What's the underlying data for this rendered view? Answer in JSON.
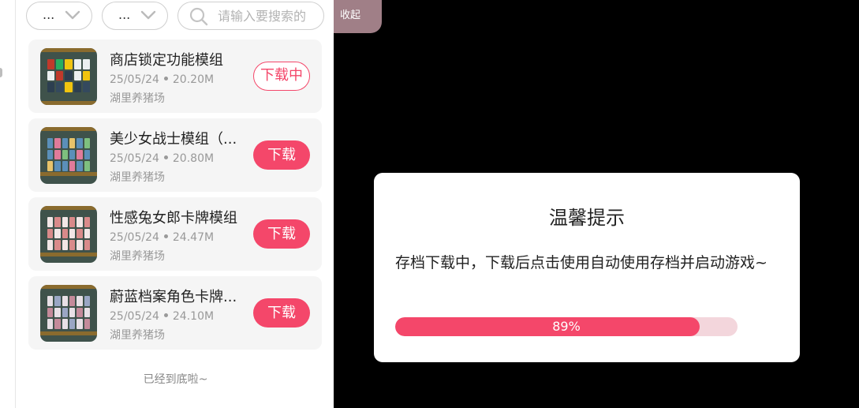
{
  "filters": [
    {
      "label": "..."
    },
    {
      "label": "..."
    }
  ],
  "search": {
    "placeholder": "请输入要搜索的"
  },
  "collapse_label": "收起",
  "mods": [
    {
      "title": "商店锁定功能模组",
      "date": "25/05/24",
      "size": "20.20M",
      "author": "湖里养猪场",
      "button": "下载中",
      "state": "downloading"
    },
    {
      "title": "美少女战士模组（...",
      "date": "25/05/24",
      "size": "20.80M",
      "author": "湖里养猪场",
      "button": "下载",
      "state": "idle"
    },
    {
      "title": "性感兔女郎卡牌模组",
      "date": "25/05/24",
      "size": "24.47M",
      "author": "湖里养猪场",
      "button": "下载",
      "state": "idle"
    },
    {
      "title": "蔚蓝档案角色卡牌...",
      "date": "25/05/24",
      "size": "24.10M",
      "author": "湖里养猪场",
      "button": "下载",
      "state": "idle"
    }
  ],
  "end_text": "已经到底啦~",
  "dialog": {
    "title": "温馨提示",
    "message": "存档下载中，下载后点击使用自动使用存档并启动游戏~",
    "progress": 0.89,
    "progress_label": "89%"
  },
  "colors": {
    "accent": "#f4476a",
    "collapse": "#a07f87",
    "card_bg": "#f5f5f5"
  },
  "icons": [
    "chevron-down-icon",
    "search-icon"
  ]
}
